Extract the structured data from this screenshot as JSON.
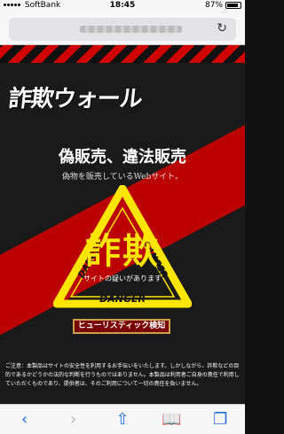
{
  "status": {
    "carrier": "SoftBank",
    "time": "18:45",
    "battery": "87%"
  },
  "browser": {
    "reload_icon": "reload-icon"
  },
  "page": {
    "logo": "詐欺ウォール",
    "title": "偽販売、違法販売",
    "subtitle": "偽物を販売しているWebサイト。",
    "danger_label_left": "DANGER",
    "danger_label_right": "DANGER",
    "big_word": "詐欺",
    "suspicion": "サイトの疑いがあります",
    "danger_label_bottom": "DANGER",
    "button": "ヒューリスティック検知",
    "disclaimer": "ご注意：本製品はサイトの安全性を利用するお手伝いをいたします。しかしながら、詐欺などの目的であるかどうかの法的な判断を行うものではありません。本製品は利用者ご自身の責任で利用していただくものであり、提供者は、そのご利用について一切の責任を負いません。"
  },
  "colors": {
    "accent_red": "#c40000",
    "warning_yellow": "#ffe500",
    "link_blue": "#1e6ee6"
  }
}
